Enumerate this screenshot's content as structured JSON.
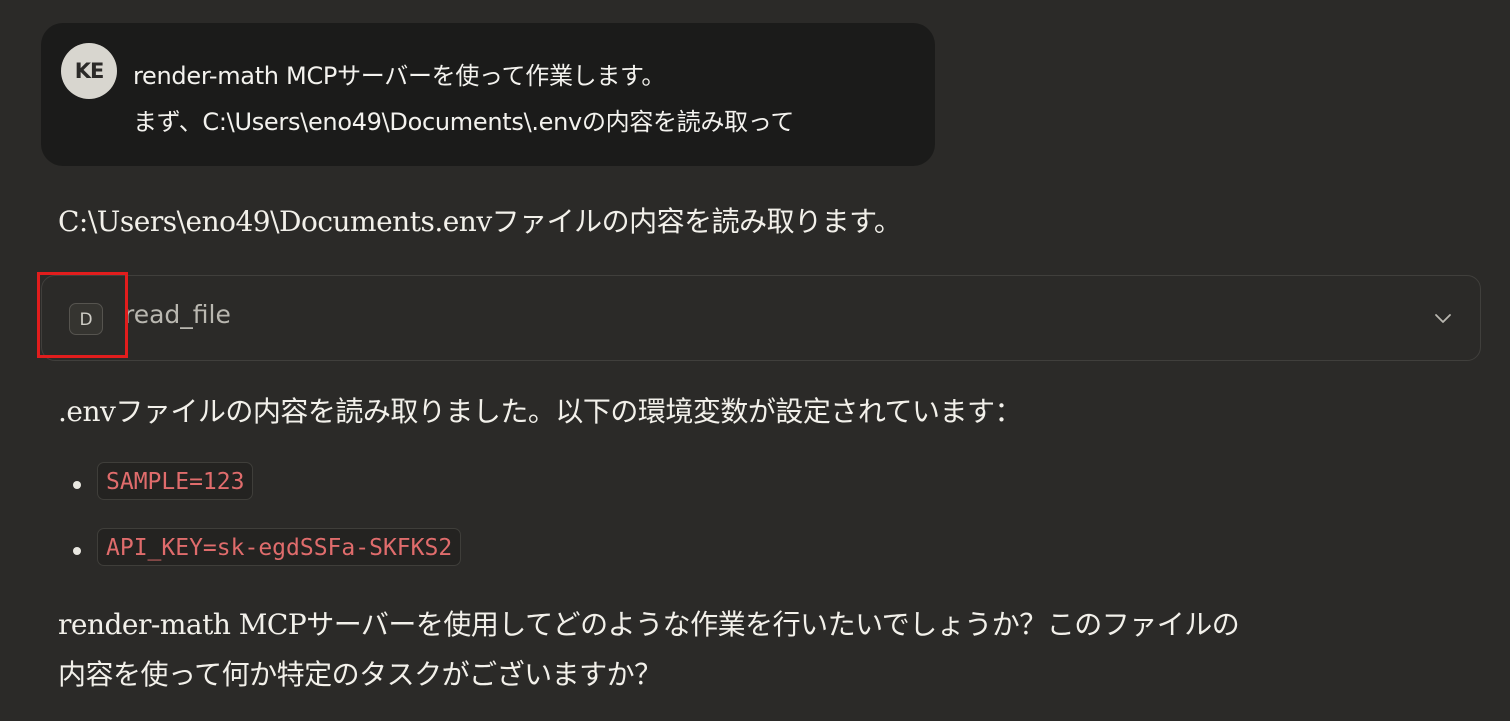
{
  "user_message": {
    "avatar_initials": "KE",
    "line1": "render-math MCPサーバーを使って作業します。",
    "line2": "まず、C:\\Users\\eno49\\Documents\\.envの内容を読み取って"
  },
  "assistant": {
    "intro": "C:\\Users\\eno49\\Documents.envファイルの内容を読み取ります。",
    "tool_call": {
      "badge": "D",
      "name": "read_file",
      "chevron_icon": "chevron-down-icon"
    },
    "result_intro": ".envファイルの内容を読み取りました。以下の環境変数が設定されています：",
    "env_vars": [
      "SAMPLE=123",
      "API_KEY=sk-egdSSFa-SKFKS2"
    ],
    "followup_line1": "render-math MCPサーバーを使用してどのような作業を行いたいでしょうか？このファイルの",
    "followup_line2": "内容を使って何か特定のタスクがございますか？"
  },
  "colors": {
    "background": "#2b2a28",
    "user_bubble": "#1b1b1a",
    "code_text": "#e06c6c",
    "highlight": "#e11d1d"
  }
}
